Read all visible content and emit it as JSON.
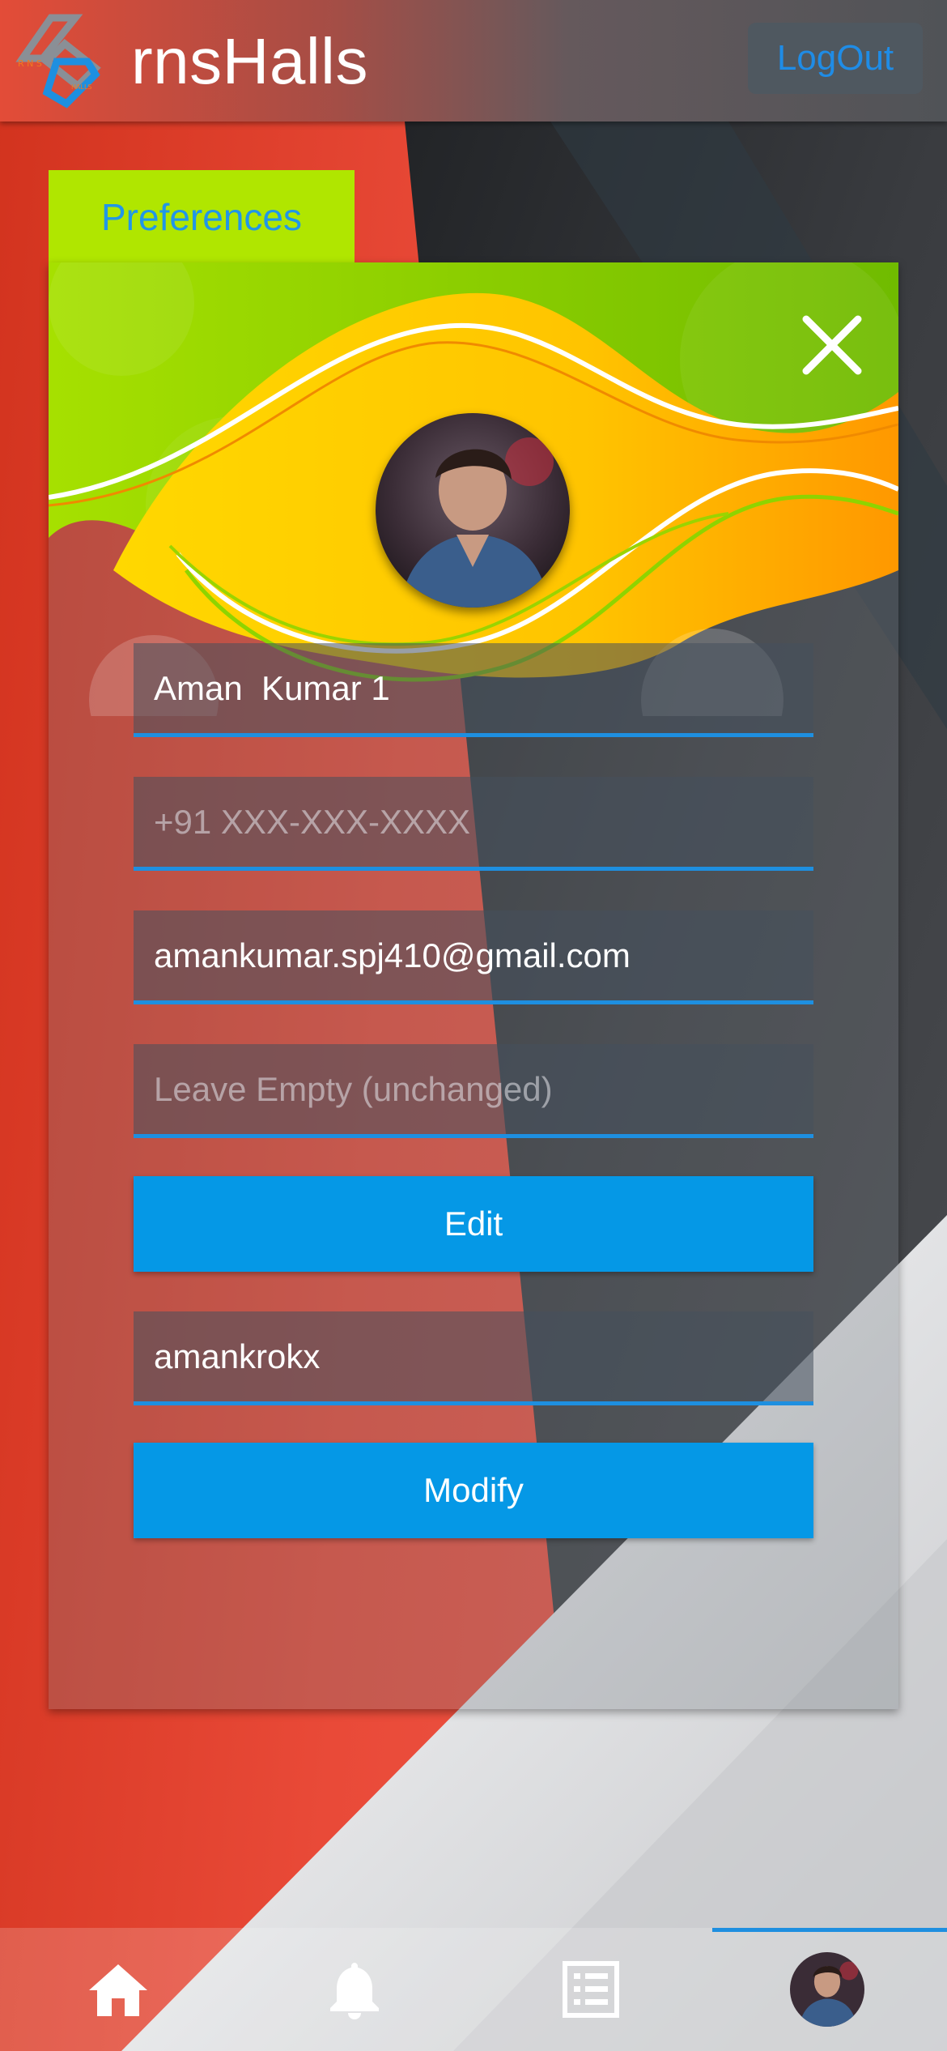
{
  "header": {
    "app_title": "rnsHalls",
    "logout_label": "LogOut",
    "logo_icon": "rns-halls-logo-icon"
  },
  "card": {
    "tab_label": "Preferences",
    "close_icon": "close-icon",
    "avatar_icon": "profile-avatar"
  },
  "form": {
    "name": {
      "value": "Aman  Kumar 1",
      "placeholder": ""
    },
    "phone": {
      "value": "",
      "placeholder": "+91 XXX-XXX-XXXX"
    },
    "email": {
      "value": "amankumar.spj410@gmail.com",
      "placeholder": ""
    },
    "password": {
      "value": "",
      "placeholder": "Leave Empty (unchanged)"
    },
    "edit_label": "Edit",
    "username": {
      "value": "amankrokx",
      "placeholder": ""
    },
    "modify_label": "Modify"
  },
  "bottom_nav": {
    "items": [
      {
        "icon": "home-icon",
        "active": false
      },
      {
        "icon": "bell-icon",
        "active": false
      },
      {
        "icon": "list-icon",
        "active": false
      },
      {
        "icon": "profile-avatar",
        "active": true
      }
    ]
  },
  "colors": {
    "accent": "#0598e6",
    "tab_green": "#b0e600",
    "logout_text": "#1f8ce6"
  }
}
